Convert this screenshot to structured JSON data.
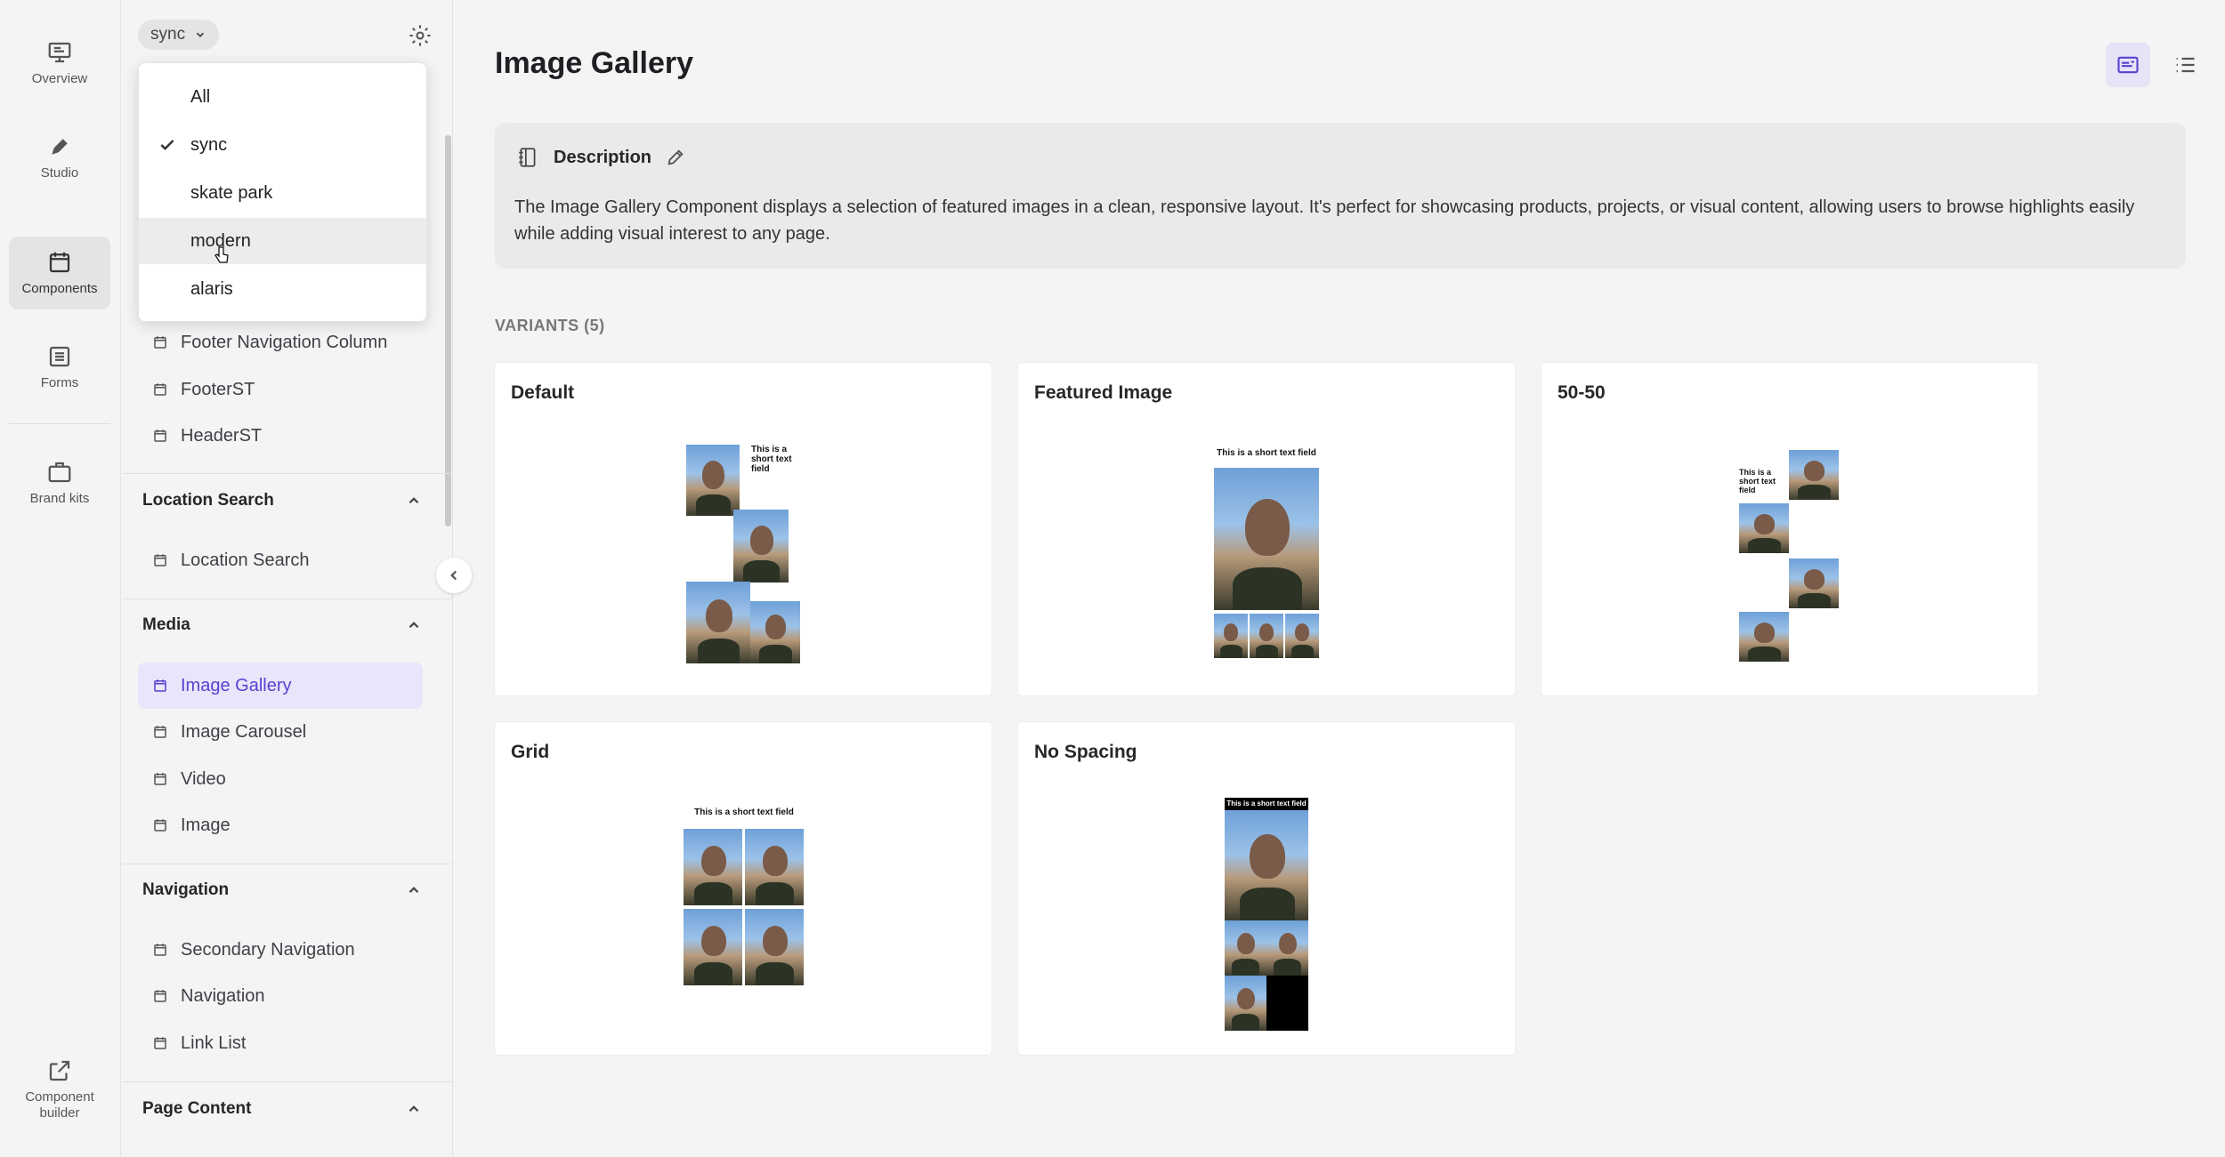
{
  "rail": {
    "items": [
      {
        "label": "Overview",
        "icon": "monitor-icon"
      },
      {
        "label": "Studio",
        "icon": "pen-icon"
      },
      {
        "label": "Components",
        "icon": "calendar-icon",
        "active": true
      },
      {
        "label": "Forms",
        "icon": "list-icon"
      },
      {
        "label": "Brand kits",
        "icon": "briefcase-icon"
      },
      {
        "label": "Component builder",
        "icon": "external-link-icon"
      }
    ]
  },
  "sidebar": {
    "theme_chip": "sync",
    "dropdown": {
      "options": [
        "All",
        "sync",
        "skate park",
        "modern",
        "alaris"
      ],
      "selected": "sync",
      "hovered": "modern"
    },
    "loose_items": [
      "Footer Navigation Column",
      "FooterST",
      "HeaderST"
    ],
    "sections": [
      {
        "title": "Location Search",
        "items": [
          "Location Search"
        ]
      },
      {
        "title": "Media",
        "items": [
          "Image Gallery",
          "Image Carousel",
          "Video",
          "Image"
        ],
        "active": "Image Gallery"
      },
      {
        "title": "Navigation",
        "items": [
          "Secondary Navigation",
          "Navigation",
          "Link List"
        ]
      },
      {
        "title": "Page Content",
        "items": []
      }
    ]
  },
  "main": {
    "title": "Image Gallery",
    "description": {
      "heading": "Description",
      "text": "The Image Gallery Component displays a selection of featured images in a clean, responsive layout. It's perfect for showcasing products, projects, or visual content, allowing users to browse highlights easily while adding visual interest to any page."
    },
    "variants_label": "VARIANTS (5)",
    "variants": [
      {
        "title": "Default",
        "preview_text": "This is a short text field"
      },
      {
        "title": "Featured Image",
        "preview_text": "This is a short text field"
      },
      {
        "title": "50-50",
        "preview_text": "This is a short text field"
      },
      {
        "title": "Grid",
        "preview_text": "This is a short text field"
      },
      {
        "title": "No Spacing",
        "preview_text": "This is a short text field"
      }
    ]
  },
  "colors": {
    "accent": "#5b3fd0",
    "accent_bg": "#e9e5fb",
    "background": "#f4f4f5"
  }
}
